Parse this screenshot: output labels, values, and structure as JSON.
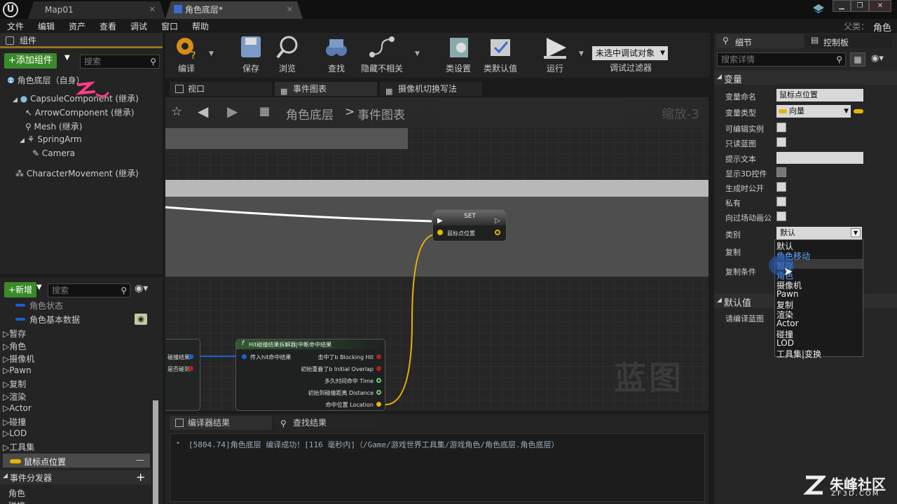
{
  "titlebar": {
    "logo": "U",
    "tabs": [
      {
        "label": "Map01",
        "active": false
      },
      {
        "label": "角色底层*",
        "active": true
      }
    ],
    "parent_label": "父类：",
    "parent_value": "角色"
  },
  "menu": [
    "文件",
    "编辑",
    "资产",
    "查看",
    "调试",
    "窗口",
    "帮助"
  ],
  "components": {
    "header": "组件",
    "add_button": "+添加组件",
    "search_placeholder": "搜索",
    "self_item": "角色底层（自身）",
    "tree": [
      {
        "label": "CapsuleComponent (继承)",
        "indent": 0
      },
      {
        "label": "ArrowComponent (继承)",
        "indent": 1
      },
      {
        "label": "Mesh (继承)",
        "indent": 1
      },
      {
        "label": "SpringArm",
        "indent": 1
      },
      {
        "label": "Camera",
        "indent": 2
      },
      {
        "label": "CharacterMovement (继承)",
        "indent": 0
      }
    ]
  },
  "myblueprint": {
    "add_button": "+新增",
    "search_placeholder": "搜索",
    "vars_top": [
      "角色状态",
      "角色基本数据"
    ],
    "categories": [
      "暂存",
      "角色",
      "摄像机",
      "Pawn",
      "复制",
      "渲染",
      "Actor",
      "碰撞",
      "LOD",
      "工具集"
    ],
    "selected_var": "鼠标点位置",
    "dispatcher_header": "事件分发器",
    "dispatcher_items": [
      "角色",
      "碰撞"
    ]
  },
  "toolbar": {
    "buttons": [
      "编译",
      "保存",
      "浏览",
      "查找",
      "隐藏不相关",
      "类设置",
      "类默认值",
      "运行"
    ],
    "debug_select": "未选中调试对象",
    "debug_filter": "调试过滤器"
  },
  "graph": {
    "tabs": [
      "视口",
      "事件图表",
      "摄像机切换写法"
    ],
    "breadcrumb_root": "角色底层",
    "breadcrumb_sep": ">",
    "breadcrumb_leaf": "事件图表",
    "zoom": "缩放-3",
    "watermark": "蓝图",
    "set_node": {
      "title": "SET",
      "pin": "鼠标点位置"
    },
    "break_node": {
      "title": "Hit碰撞结果拆解器|中断命中结果",
      "input": "传入hit命中结果",
      "outputs": [
        "击中了b Blocking Hit",
        "初始重叠了b Initial Overlap",
        "多久时间命中 Time",
        "初始到碰撞距离 Distance",
        "命中位置 Location"
      ]
    },
    "left_node_pins": [
      "碰撞结果",
      "是否碰到"
    ]
  },
  "output": {
    "tabs": [
      "编译器结果",
      "查找结果"
    ],
    "log": "[5804.74]角色底层 编译成功！[116 毫秒内]（/Game/游戏世界工具集/游戏角色/角色底层.角色底层）"
  },
  "details": {
    "tabs": [
      "细节",
      "控制板"
    ],
    "search_placeholder": "搜索详情",
    "section_variable": "变量",
    "props": {
      "var_name_label": "变量命名",
      "var_name_value": "鼠标点位置",
      "var_type_label": "变量类型",
      "var_type_value": "向量",
      "editable_label": "可编辑实例",
      "readonly_label": "只读蓝图",
      "tooltip_label": "提示文本",
      "show3d_label": "显示3D控件",
      "spawn_label": "生成时公开",
      "private_label": "私有",
      "cinematic_label": "向过场动画公",
      "category_label": "类别",
      "category_value": "默认",
      "replication_label": "复制",
      "repcond_label": "复制条件"
    },
    "category_options": [
      "默认",
      "角色移动",
      "暂存",
      "角色",
      "摄像机",
      "Pawn",
      "复制",
      "渲染",
      "Actor",
      "碰撞",
      "LOD",
      "工具集|变换"
    ],
    "section_default": "默认值",
    "default_hint": "请编译蓝图"
  },
  "watermark_brand": {
    "text": "朱峰社区",
    "url": "ZF3D.COM"
  },
  "colors": {
    "vector_pin": "#e8b400",
    "add_green": "#3a8a2a",
    "struct_blue": "#1a5fd1",
    "exec_white": "#ffffff",
    "annotation_pink": "#ff3c8c"
  }
}
